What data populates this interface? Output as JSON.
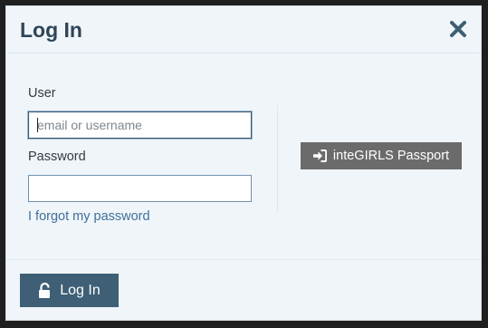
{
  "modal": {
    "title": "Log In",
    "close_icon": "close-icon"
  },
  "form": {
    "user_label": "User",
    "user_placeholder": "email or username",
    "user_value": "",
    "password_label": "Password",
    "password_value": "",
    "forgot_link": "I forgot my password"
  },
  "passport": {
    "label": "inteGIRLS Passport",
    "icon": "sign-in-icon"
  },
  "footer": {
    "login_label": "Log In",
    "login_icon": "unlock-icon"
  },
  "colors": {
    "modal_bg": "#f0f5fa",
    "title": "#2f4557",
    "link": "#3f6f98",
    "passport_button": "#6b6b6b",
    "login_button": "#3e5f75"
  }
}
